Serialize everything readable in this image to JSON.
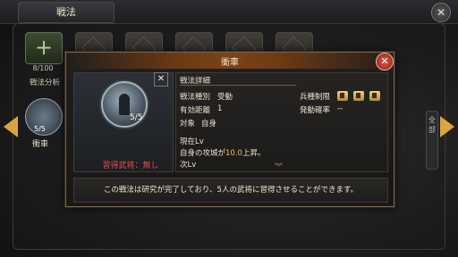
{
  "window": {
    "title": "戦法"
  },
  "strip": {
    "count": "8/100",
    "analysis_label": "戦法分析"
  },
  "left_skill": {
    "count": "5/5",
    "name": "衝車"
  },
  "side_tab": {
    "label": "全部"
  },
  "modal": {
    "title": "衝車",
    "skill_level": "5/5",
    "learned_generals": "習得武将：無し",
    "details_header": "戦法詳細",
    "type_label": "戦法種別",
    "type_value": "受動",
    "restriction_label": "兵種制限",
    "range_label": "有効距離",
    "range_value": "1",
    "rate_label": "発動確率",
    "rate_value": "--",
    "target_label": "対象",
    "target_value": "自身",
    "current_lv_label": "現在Lv",
    "effect_prefix": "自身の攻城が",
    "effect_value": "10.0",
    "effect_suffix": "上昇。",
    "next_lv_label": "次Lv",
    "footer_text": "この戦法は研究が完了しており、5人の武将に習得させることができます。"
  },
  "colors": {
    "accent_gold": "#d8a53a",
    "header_bar": "#7b4318",
    "close_red": "#c13a2e",
    "warning_red": "#e05050",
    "highlight_yellow": "#e7c15a"
  }
}
